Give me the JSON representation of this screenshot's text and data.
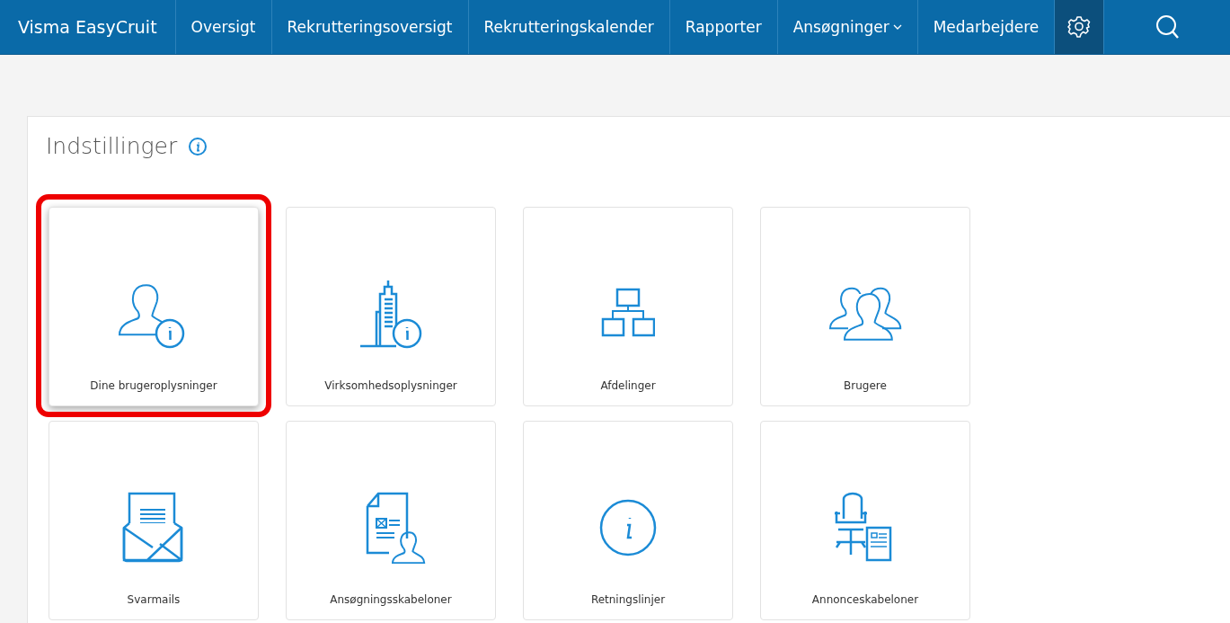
{
  "nav": {
    "brand": "Visma EasyCruit",
    "items": [
      {
        "label": "Oversigt",
        "kind": "link"
      },
      {
        "label": "Rekrutteringsoversigt",
        "kind": "link"
      },
      {
        "label": "Rekrutteringskalender",
        "kind": "link"
      },
      {
        "label": "Rapporter",
        "kind": "link"
      },
      {
        "label": "Ansøgninger",
        "kind": "dropdown"
      },
      {
        "label": "Medarbejdere",
        "kind": "link"
      }
    ],
    "settings_button": {
      "selected": true
    }
  },
  "panel": {
    "title": "Indstillinger",
    "tiles": [
      {
        "label": "Dine brugeroplysninger",
        "kind": "user-info",
        "highlighted": true
      },
      {
        "label": "Virksomhedsoplysninger",
        "kind": "building-info",
        "highlighted": false
      },
      {
        "label": "Afdelinger",
        "kind": "org-chart",
        "highlighted": false
      },
      {
        "label": "Brugere",
        "kind": "users",
        "highlighted": false
      },
      {
        "label": "Svarmails",
        "kind": "mail",
        "highlighted": false
      },
      {
        "label": "Ansøgningsskabeloner",
        "kind": "doc-user",
        "highlighted": false
      },
      {
        "label": "Retningslinjer",
        "kind": "info",
        "highlighted": false
      },
      {
        "label": "Annonceskabeloner",
        "kind": "chair-doc",
        "highlighted": false
      }
    ]
  }
}
